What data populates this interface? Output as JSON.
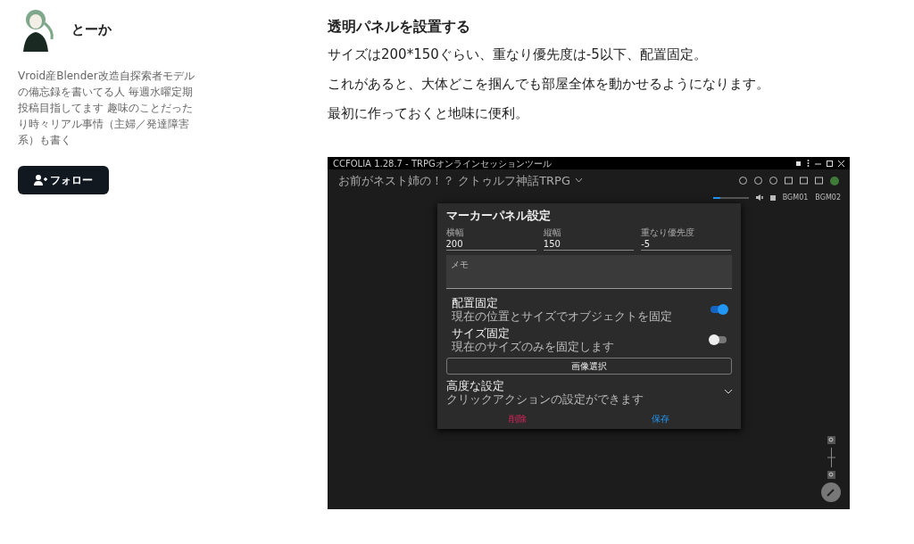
{
  "author": {
    "name": "とーか",
    "bio": "Vroid産Blender改造自探索者モデルの備忘録を書いてる人 毎週水曜定期投稿目指してます 趣味のことだったり時々リアル事情（主婦／発達障害系）も書く",
    "follow_button": "フォロー"
  },
  "article": {
    "heading": "透明パネルを設置する",
    "paragraphs": [
      "サイズは200*150ぐらい、重なり優先度は-5以下、配置固定。",
      "これがあると、大体どこを掴んでも部屋全体を動かせるようになります。",
      "最初に作っておくと地味に便利。"
    ]
  },
  "app_window": {
    "title": "CCFOLIA 1.28.7 - TRPGオンラインセッションツール",
    "room": "お前がネスト姉の！？ クトゥルフ神話TRPG",
    "volume": {
      "level": 0.2
    },
    "bgm_buttons": [
      "BGM01",
      "BGM02"
    ],
    "dialog": {
      "title": "マーカーパネル設定",
      "fields": [
        {
          "label": "横幅",
          "value": "200"
        },
        {
          "label": "縦幅",
          "value": "150"
        },
        {
          "label": "重なり優先度",
          "value": "-5"
        }
      ],
      "memo": {
        "placeholder": "メモ"
      },
      "toggles": [
        {
          "title": "配置固定",
          "description": "現在の位置とサイズでオブジェクトを固定",
          "on": true
        },
        {
          "title": "サイズ固定",
          "description": "現在のサイズのみを固定します",
          "on": false
        }
      ],
      "image_button": "画像選択",
      "advanced": {
        "title": "高度な設定",
        "subtitle": "クリックアクションの設定ができます",
        "expanded": false
      },
      "delete_button": "削除",
      "save_button": "保存"
    }
  }
}
